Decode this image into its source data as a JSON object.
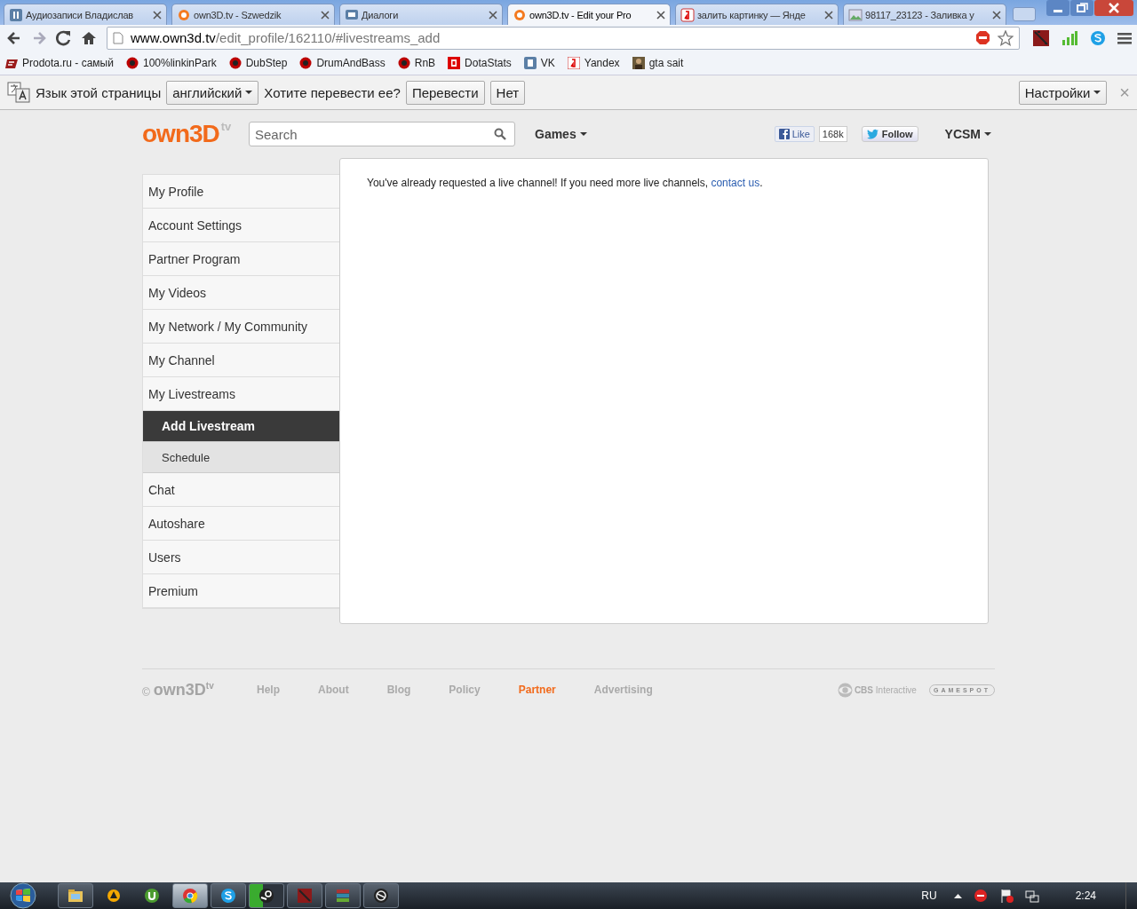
{
  "browser": {
    "tabs": [
      {
        "title": "Аудиозаписи Владислав",
        "selected": false
      },
      {
        "title": "own3D.tv - Szwedzik",
        "selected": false
      },
      {
        "title": "Диалоги",
        "selected": false
      },
      {
        "title": "own3D.tv - Edit your Pro",
        "selected": true
      },
      {
        "title": "залить картинку — Янде",
        "selected": false
      },
      {
        "title": "98117_23123 - Заливка у",
        "selected": false
      }
    ],
    "address": {
      "host": "www.own3d.tv",
      "path": "/edit_profile/162110/#livestreams_add"
    },
    "bookmarks": [
      "Prodota.ru - самый",
      "100%linkinPark",
      "DubStep",
      "DrumAndBass",
      "RnB",
      "DotaStats",
      "VK",
      "Yandex",
      "gta sait"
    ]
  },
  "translate_bar": {
    "label": "Язык этой страницы",
    "language": "английский",
    "question": "Хотите перевести ее?",
    "translate": "Перевести",
    "decline": "Нет",
    "settings": "Настройки",
    "close": "×"
  },
  "header": {
    "logo": "own3D",
    "logo_sup": "tv",
    "search": {
      "placeholder": "Search"
    },
    "games": "Games",
    "like": "Like",
    "like_count": "168k",
    "follow": "Follow",
    "user": "YCSM"
  },
  "sidebar": {
    "items": [
      {
        "label": "My Profile",
        "selected": false
      },
      {
        "label": "Account Settings",
        "selected": false
      },
      {
        "label": "Partner Program",
        "selected": false
      },
      {
        "label": "My Videos",
        "selected": false
      },
      {
        "label": "My Network / My Community",
        "selected": false
      },
      {
        "label": "My Channel",
        "selected": false
      },
      {
        "label": "My Livestreams",
        "selected": false,
        "expanded": true,
        "children": [
          {
            "label": "Add Livestream",
            "selected": true
          },
          {
            "label": "Schedule",
            "selected": false
          }
        ]
      },
      {
        "label": "Chat",
        "selected": false
      },
      {
        "label": "Autoshare",
        "selected": false
      },
      {
        "label": "Users",
        "selected": false
      },
      {
        "label": "Premium",
        "selected": false
      }
    ]
  },
  "content": {
    "message": "You've already requested a live channel! If you need more live channels, ",
    "link": "contact us",
    "end": "."
  },
  "footer": {
    "copyright": "©",
    "logo": "own3D",
    "logo_sup": "tv",
    "links": [
      {
        "label": "Help",
        "selected": false
      },
      {
        "label": "About",
        "selected": false
      },
      {
        "label": "Blog",
        "selected": false
      },
      {
        "label": "Policy",
        "selected": false
      },
      {
        "label": "Partner",
        "selected": true
      },
      {
        "label": "Advertising",
        "selected": false
      }
    ],
    "cbs": "**CBS** Interactive",
    "gamespot": "GAMESPOT"
  },
  "taskbar": {
    "apps": [
      {
        "running": true,
        "selected": false
      },
      {
        "running": false,
        "selected": false
      },
      {
        "running": false,
        "selected": false
      },
      {
        "running": true,
        "selected": true
      },
      {
        "running": true,
        "selected": false
      },
      {
        "running": true,
        "selected": false
      },
      {
        "running": true,
        "selected": false
      },
      {
        "running": true,
        "selected": false
      },
      {
        "running": true,
        "selected": false
      }
    ],
    "language": "RU",
    "clock": "2:24"
  }
}
